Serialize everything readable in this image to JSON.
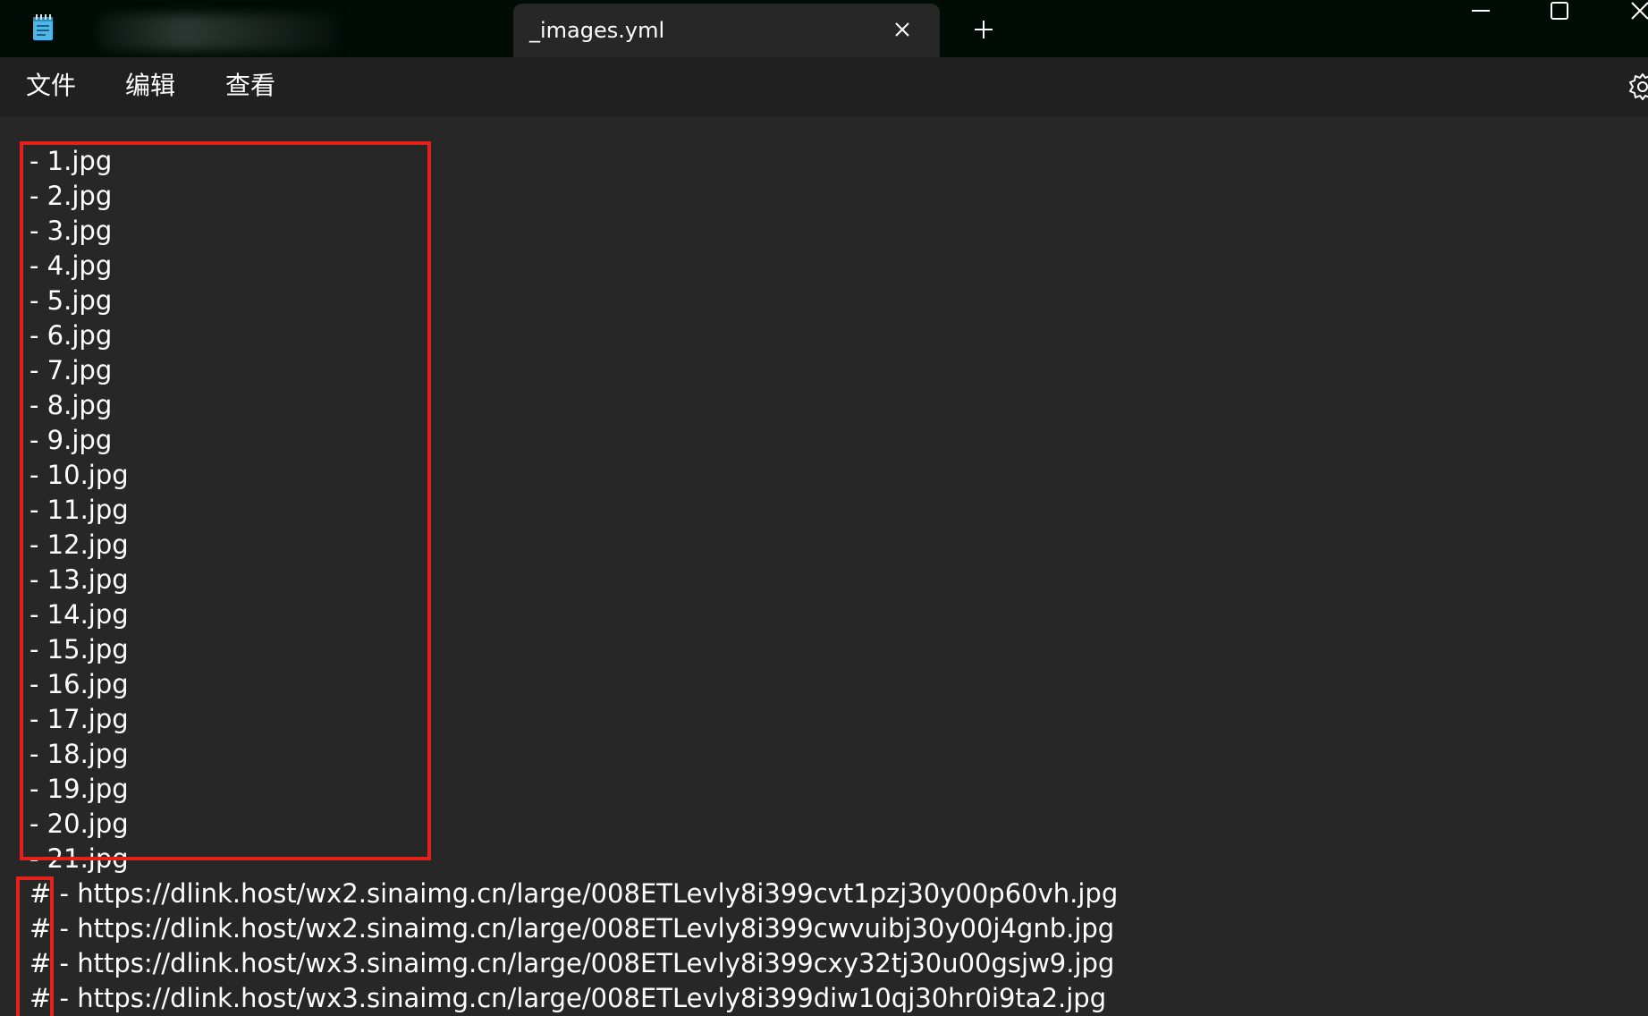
{
  "window": {
    "tab_title": "_images.yml",
    "colors": {
      "titlebar_bg": "#020c07",
      "menubar_bg": "#202020",
      "editor_bg": "#272727",
      "text": "#ffffff",
      "highlight_box": "#e8201b",
      "app_icon": "#4fb6e8"
    },
    "icons": {
      "app": "notepad-icon",
      "tab_close": "close-icon",
      "new_tab": "plus-icon",
      "minimize": "minimize-icon",
      "maximize": "maximize-icon",
      "close": "close-icon",
      "settings": "gear-icon"
    }
  },
  "menu": {
    "items": [
      "文件",
      "编辑",
      "查看"
    ]
  },
  "editor": {
    "lines": [
      "- 1.jpg",
      "- 2.jpg",
      "- 3.jpg",
      "- 4.jpg",
      "- 5.jpg",
      "- 6.jpg",
      "- 7.jpg",
      "- 8.jpg",
      "- 9.jpg",
      "- 10.jpg",
      "- 11.jpg",
      "- 12.jpg",
      "- 13.jpg",
      "- 14.jpg",
      "- 15.jpg",
      "- 16.jpg",
      "- 17.jpg",
      "- 18.jpg",
      "- 19.jpg",
      "- 20.jpg",
      "- 21.jpg",
      "# - https://dlink.host/wx2.sinaimg.cn/large/008ETLevly8i399cvt1pzj30y00p60vh.jpg",
      "# - https://dlink.host/wx2.sinaimg.cn/large/008ETLevly8i399cwvuibj30y00j4gnb.jpg",
      "# - https://dlink.host/wx3.sinaimg.cn/large/008ETLevly8i399cxy32tj30u00gsjw9.jpg",
      "# - https://dlink.host/wx3.sinaimg.cn/large/008ETLevly8i399diw10qj30hr0i9ta2.jpg"
    ]
  }
}
